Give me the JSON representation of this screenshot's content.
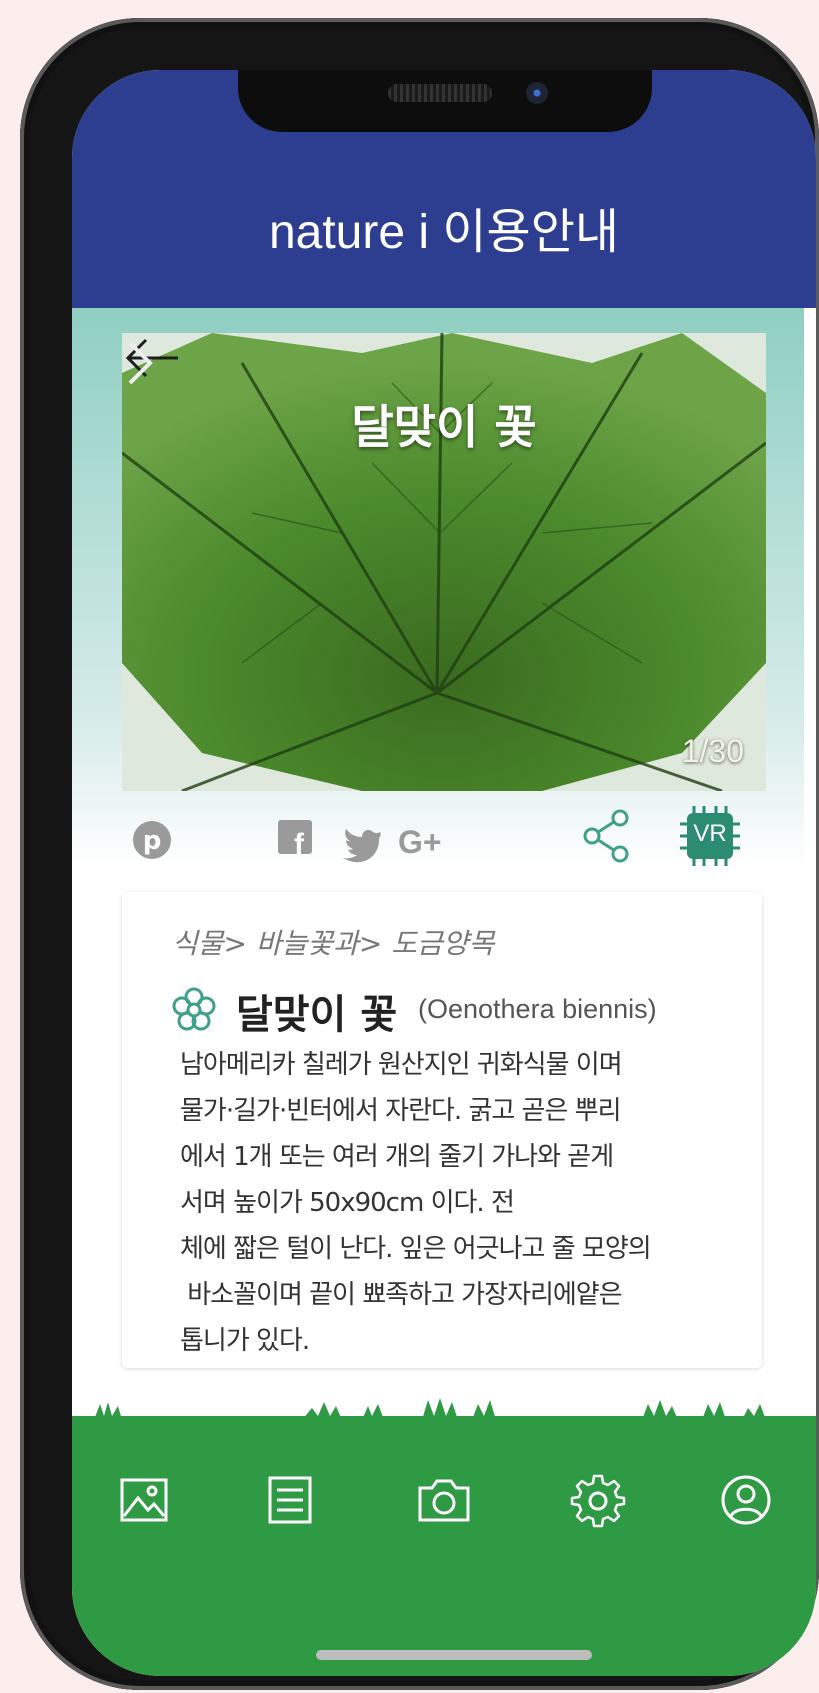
{
  "header": {
    "title": "nature i 이용안내"
  },
  "gallery": {
    "title": "달맞이 꽃",
    "counter": "1/30"
  },
  "share_bar": {
    "vr_label": "VR",
    "icons": [
      "pinterest-icon",
      "facebook-icon",
      "twitter-icon",
      "google-plus-icon",
      "share-icon",
      "vr-icon"
    ]
  },
  "detail": {
    "breadcrumb": "식물> 바늘꽃과> 도금양목",
    "name": "달맞이 꽃",
    "scientific_name": "(Oenothera biennis)",
    "description_lines": [
      "남아메리카 칠레가 원산지인 귀화식물 이며",
      "물가·길가·빈터에서 자란다. 굵고 곧은 뿌리",
      "에서 1개 또는 여러 개의 줄기 가나와 곧게",
      "서며 높이가 50x90cm 이다. 전",
      "체에 짧은 털이 난다. 잎은 어긋나고 줄 모양의",
      " 바소꼴이며 끝이 뾰족하고 가장자리에얕은",
      "톱니가 있다."
    ]
  },
  "bottom_nav": {
    "items": [
      "gallery-icon",
      "list-icon",
      "camera-icon",
      "settings-icon",
      "profile-icon"
    ]
  },
  "colors": {
    "header": "#2d3e91",
    "nav": "#2e9a44",
    "accent_teal": "#3fa08a"
  }
}
